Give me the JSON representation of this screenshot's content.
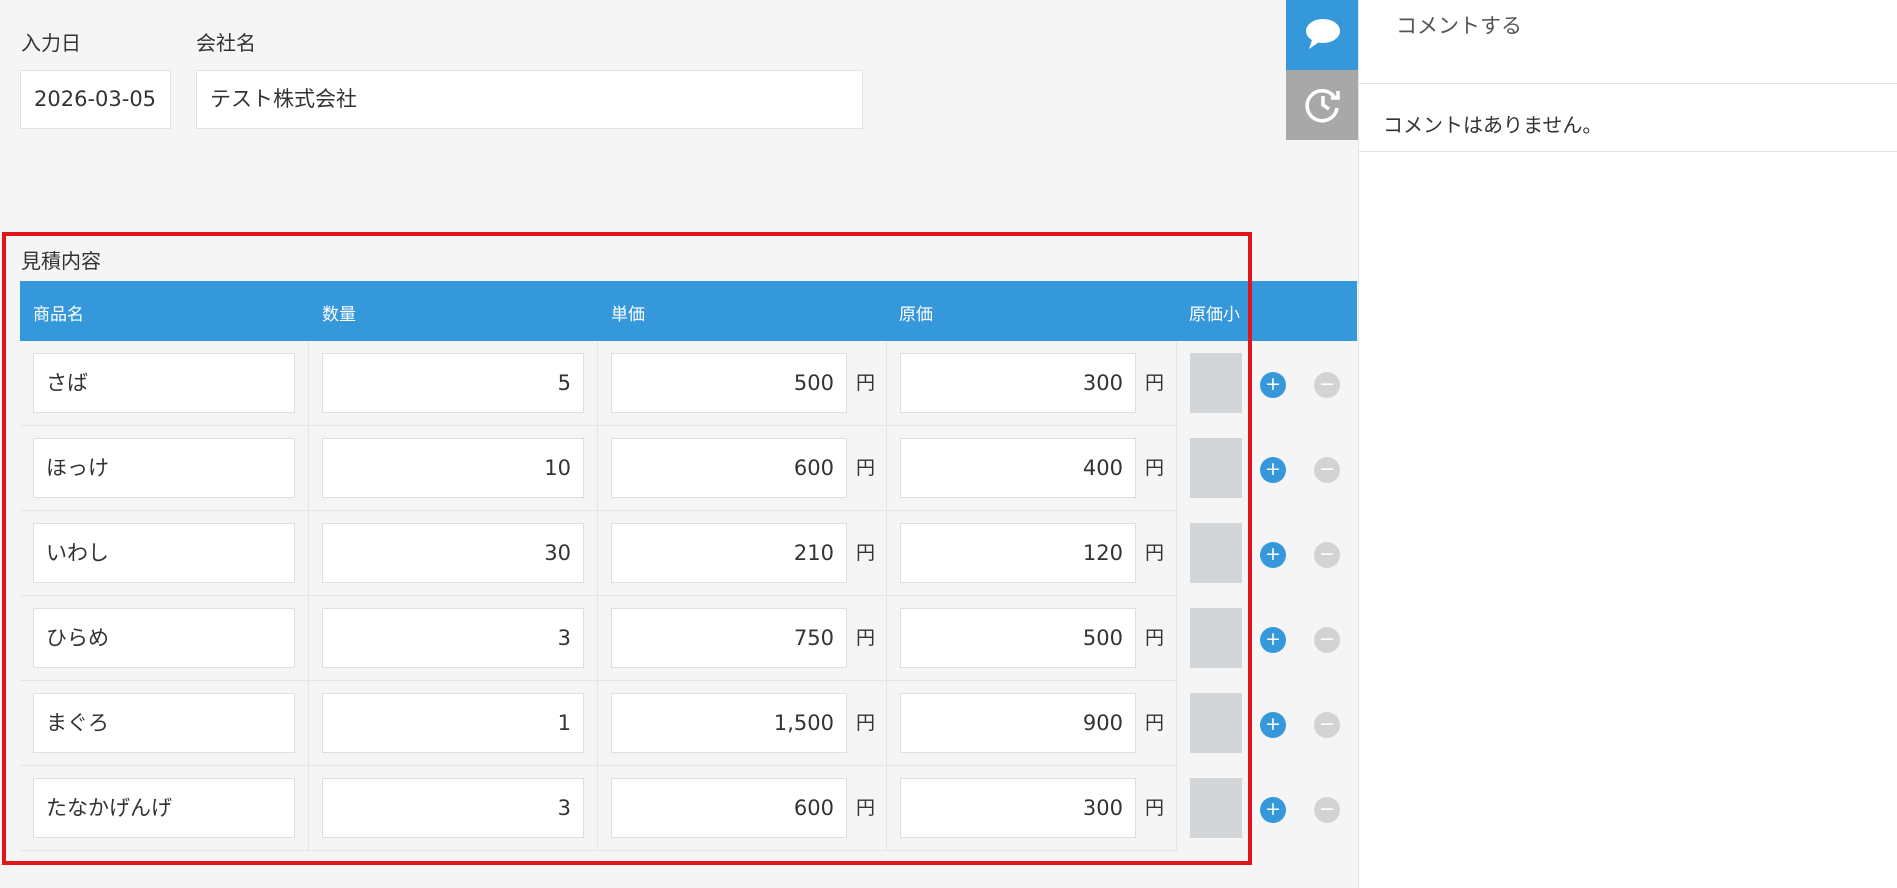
{
  "record": {
    "date_label": "入力日",
    "date_value": "2026-03-05",
    "company_label": "会社名",
    "company_value": "テスト株式会社"
  },
  "comments": {
    "input_placeholder": "コメントする",
    "empty_text": "コメントはありません。"
  },
  "table": {
    "section_label": "見積内容",
    "columns": [
      "商品名",
      "数量",
      "単価",
      "原価",
      "原価小"
    ],
    "currency": "円",
    "rows": [
      {
        "product": "さば",
        "qty": "5",
        "unit_price": "500",
        "cost": "300"
      },
      {
        "product": "ほっけ",
        "qty": "10",
        "unit_price": "600",
        "cost": "400"
      },
      {
        "product": "いわし",
        "qty": "30",
        "unit_price": "210",
        "cost": "120"
      },
      {
        "product": "ひらめ",
        "qty": "3",
        "unit_price": "750",
        "cost": "500"
      },
      {
        "product": "まぐろ",
        "qty": "1",
        "unit_price": "1,500",
        "cost": "900"
      },
      {
        "product": "たなかげんげ",
        "qty": "3",
        "unit_price": "600",
        "cost": "300"
      }
    ],
    "add_symbol": "+",
    "remove_symbol": "−"
  },
  "icons": {
    "comment_toggle": "speech-bubble-icon",
    "history_toggle": "clock-refresh-icon"
  },
  "colors": {
    "accent": "#3598db",
    "header_text": "#ffffff",
    "highlight_frame": "#e0151b",
    "page_bg": "#f5f5f5"
  }
}
